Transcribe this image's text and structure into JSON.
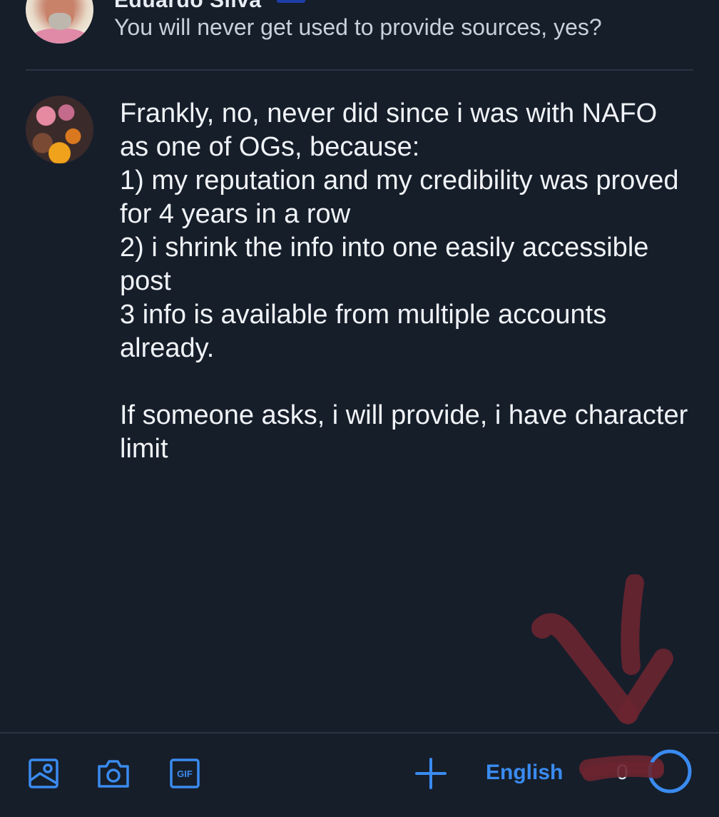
{
  "reply_context": {
    "author_name": "Eduardo Silva",
    "text": "You will never get used to provide sources, yes?"
  },
  "compose": {
    "text": "Frankly, no, never did since i was with NAFO as one of OGs, because:\n1) my reputation and my credibility was proved for 4 years in a row\n2) i shrink the info into one easily accessible post\n3 info is available from multiple accounts already.\n\nIf someone asks, i will provide, i have character limit"
  },
  "toolbar": {
    "gif_label": "GIF",
    "language": "English",
    "char_count": "0",
    "accent_color": "#3a8bf0"
  },
  "icons": [
    "image-icon",
    "camera-icon",
    "gif-icon",
    "plus-icon",
    "progress-ring-icon"
  ]
}
